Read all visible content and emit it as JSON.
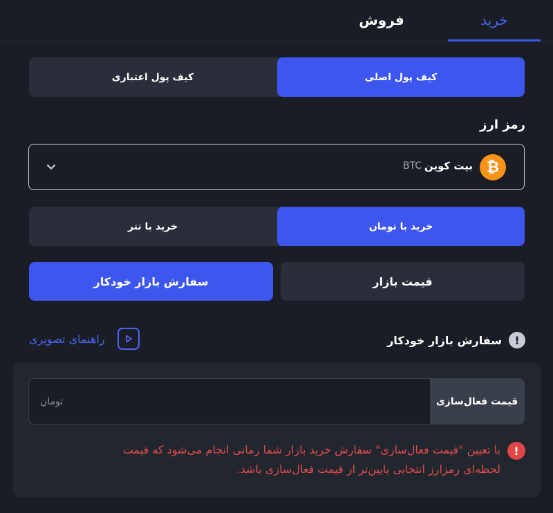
{
  "tabs": {
    "buy": "خرید",
    "sell": "فروش"
  },
  "wallet": {
    "main": "کیف پول اصلی",
    "credit": "کیف پول اعتباری"
  },
  "crypto": {
    "label": "رمز ارز",
    "selected_name": "بیت کوین",
    "selected_symbol": "BTC",
    "coin_glyph": "₿"
  },
  "currency": {
    "toman": "خرید با تومان",
    "tether": "خرید با تتر"
  },
  "order_type": {
    "auto": "سفارش بازار خودکار",
    "market": "قیمت بازار"
  },
  "section": {
    "title": "سفارش بازار خودکار",
    "guide": "راهنمای تصویری"
  },
  "price": {
    "addon": "قیمت فعال‌سازی",
    "placeholder": "تومان"
  },
  "warning": {
    "line1": "با تعیین \"قیمت فعال‌سازی\" سفارش خرید بازار شما زمانی انجام می‌شود که قیمت",
    "line2": "لحظه‌ای رمزارز انتخابی پایین‌تر از قیمت فعال‌سازی باشد."
  },
  "colors": {
    "accent": "#3d57ee",
    "danger": "#e04646",
    "bitcoin": "#f7931a"
  }
}
